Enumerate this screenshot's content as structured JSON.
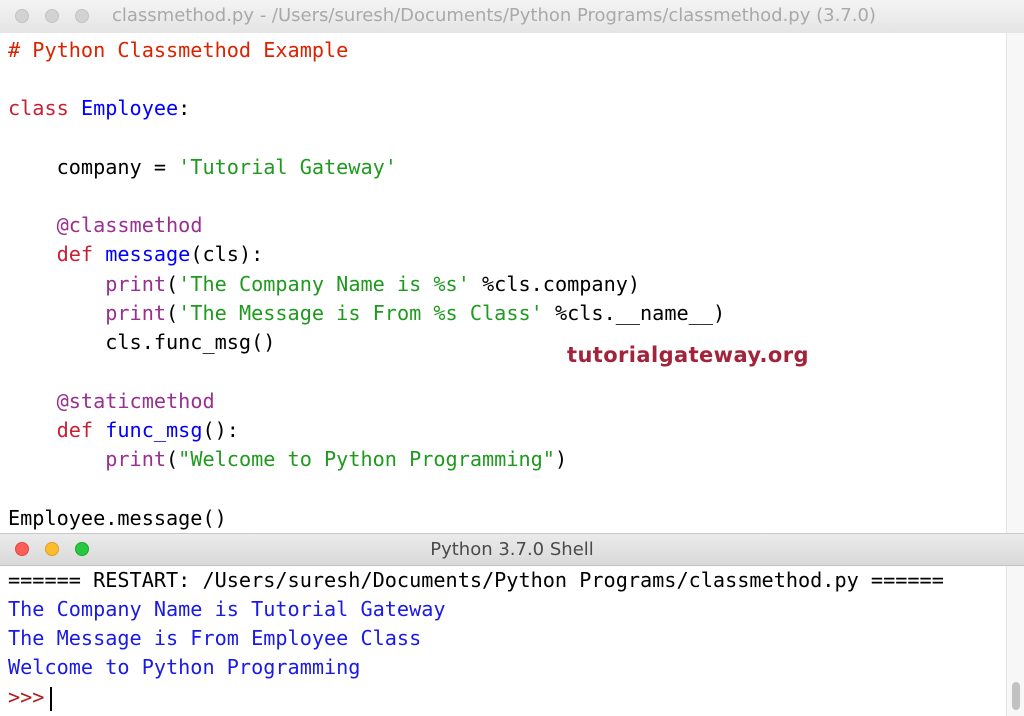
{
  "editor": {
    "title": "classmethod.py - /Users/suresh/Documents/Python Programs/classmethod.py (3.7.0)",
    "code": {
      "l1": "# Python Classmethod Example",
      "l2_kw": "class",
      "l2_name": "Employee",
      "l2_rest": ":",
      "l3_a": "    company = ",
      "l3_str": "'Tutorial Gateway'",
      "l4_dec": "@classmethod",
      "l5_kw": "def",
      "l5_name": "message",
      "l5_rest": "(cls):",
      "l6_fn": "print",
      "l6_a": "(",
      "l6_str": "'The Company Name is %s'",
      "l6_rest": " %cls.company)",
      "l7_fn": "print",
      "l7_a": "(",
      "l7_str": "'The Message is From %s Class'",
      "l7_rest": " %cls.__name__)",
      "l8": "        cls.func_msg()",
      "l9_dec": "@staticmethod",
      "l10_kw": "def",
      "l10_name": "func_msg",
      "l10_rest": "():",
      "l11_fn": "print",
      "l11_a": "(",
      "l11_str": "\"Welcome to Python Programming\"",
      "l11_rest": ")",
      "l12": "Employee.message()"
    },
    "watermark": "tutorialgateway.org"
  },
  "shell": {
    "title": "Python 3.7.0 Shell",
    "restart_line": "====== RESTART: /Users/suresh/Documents/Python Programs/classmethod.py ======",
    "outputs": [
      "The Company Name is Tutorial Gateway",
      "The Message is From Employee Class",
      "Welcome to Python Programming"
    ],
    "prompt": ">>>"
  },
  "colors": {
    "comment": "#dd2200",
    "keyword": "#c72034",
    "definition": "#0000ff",
    "string": "#1f9a1f",
    "decorator": "#9a2f8f",
    "output": "#1a1ae6",
    "prompt": "#b31b1b",
    "watermark": "#a2243a"
  }
}
